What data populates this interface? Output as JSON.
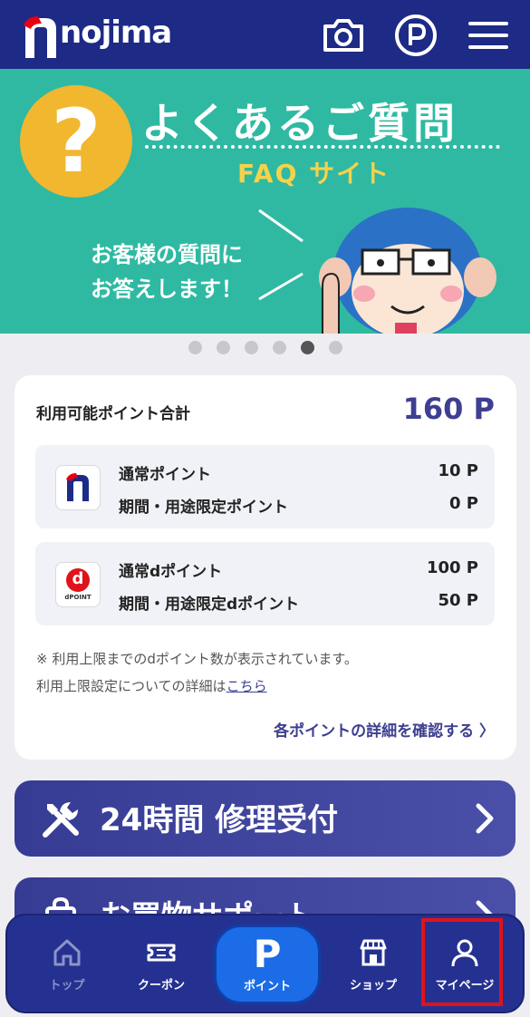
{
  "header": {
    "logo_text": "nojima",
    "camera_icon": "camera-icon",
    "points_icon": "p-circle-icon",
    "menu_icon": "hamburger-icon"
  },
  "banner": {
    "question_mark": "?",
    "title": "よくあるご質問",
    "subtitle": "FAQ サイト",
    "message": "お客様の質問に\nお答えします！"
  },
  "carousel": {
    "count": 6,
    "active_index": 4
  },
  "points": {
    "title": "利用可能ポイント合計",
    "total": "160 P",
    "nojima": {
      "normal_label": "通常ポイント",
      "normal_value": "10 P",
      "limited_label": "期間・用途限定ポイント",
      "limited_value": "0 P"
    },
    "dpoint": {
      "icon_letter": "d",
      "icon_caption": "dPOINT",
      "normal_label": "通常dポイント",
      "normal_value": "100 P",
      "limited_label": "期間・用途限定dポイント",
      "limited_value": "50 P"
    },
    "note_line1": "※ 利用上限までのdポイント数が表示されています。",
    "note_line2": "利用上限設定についての詳細は",
    "note_link": "こちら",
    "detail_link": "各ポイントの詳細を確認する 〉"
  },
  "promos": [
    {
      "label": "24時間 修理受付"
    },
    {
      "label": "お買物サポート"
    }
  ],
  "bottom_nav": {
    "items": [
      {
        "label": "トップ",
        "icon": "home-icon"
      },
      {
        "label": "クーポン",
        "icon": "ticket-icon"
      },
      {
        "label": "ポイント",
        "icon": "p-icon",
        "glyph": "P"
      },
      {
        "label": "ショップ",
        "icon": "shop-icon"
      },
      {
        "label": "マイページ",
        "icon": "user-icon"
      }
    ]
  },
  "colors": {
    "header_bg": "#1d2a86",
    "banner_bg": "#2fb9a2",
    "accent": "#3e3f91",
    "nav_active": "#1b6ce6",
    "highlight": "#e0131a"
  }
}
